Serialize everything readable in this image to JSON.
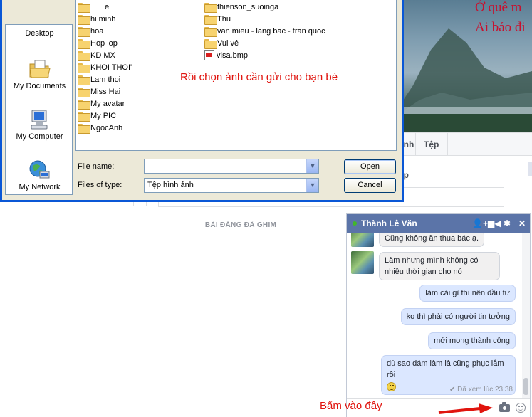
{
  "background_page": {
    "cover_text": [
      "Ở quê m",
      "Ai bảo đi"
    ],
    "tabs": [
      "ảnh",
      "Tệp"
    ],
    "section_heading": "ệp",
    "pinned_posts_title": "BÀI ĐĂNG ĐÃ GHIM"
  },
  "dialog": {
    "places": [
      {
        "label": "Desktop",
        "icon": "desktop-icon"
      },
      {
        "label": "My Documents",
        "icon": "my-documents-icon"
      },
      {
        "label": "My Computer",
        "icon": "my-computer-icon"
      },
      {
        "label": "My Network",
        "icon": "my-network-icon"
      }
    ],
    "files_col1": [
      "e",
      "hi minh",
      "hoa",
      "Hop lop",
      "KD MX",
      "KHOI THOI'",
      "Lam thoi",
      "Miss Hai",
      "My avatar",
      "My PIC",
      "NgocAnh"
    ],
    "files_col2": [
      "thienson_suoinga",
      "Thu",
      "van mieu - lang bac - tran quoc",
      "Vui vẻ"
    ],
    "image_file": "visa.bmp",
    "file_name_label": "File name:",
    "file_name_value": "",
    "files_of_type_label": "Files of type:",
    "files_of_type_value": "Tệp hình ảnh",
    "open_label": "Open",
    "cancel_label": "Cancel"
  },
  "annotations": {
    "instruction": "Rồi chọn ảnh cần gửi cho bạn bè",
    "callout": "Bấm vào đây",
    "color": "#e0140e"
  },
  "chat": {
    "contact_name": "Thành Lê Văn",
    "header_color": "#5b74a8",
    "messages": [
      {
        "from": "contact",
        "text": "Cũng không ăn thua bác ạ."
      },
      {
        "from": "contact",
        "text": "Làm nhưng mình không có nhiều thời gian cho nó"
      },
      {
        "from": "me",
        "text": "làm cái gì thì nên đầu tư"
      },
      {
        "from": "me",
        "text": "ko thì phải có người tin tưởng"
      },
      {
        "from": "me",
        "text": "mới mong thành công"
      },
      {
        "from": "me",
        "text": "dù sao dám làm là cũng phục lắm rồi"
      }
    ],
    "seen_status": "✔ Đã xem lúc 23:38"
  }
}
